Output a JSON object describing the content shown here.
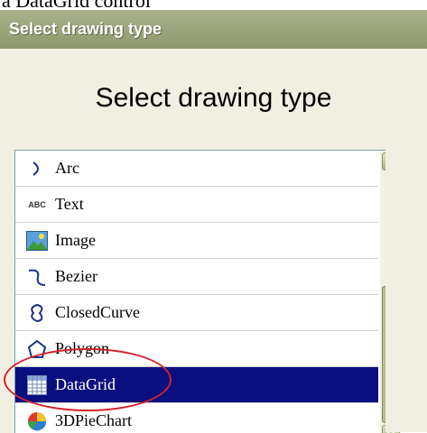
{
  "caption": "a DataGrid control",
  "window": {
    "title": "Select drawing type"
  },
  "heading": "Select drawing type",
  "list": {
    "items": [
      {
        "label": "Arc",
        "icon": "arc-icon"
      },
      {
        "label": "Text",
        "icon": "text-abc-icon"
      },
      {
        "label": "Image",
        "icon": "image-icon"
      },
      {
        "label": "Bezier",
        "icon": "bezier-icon"
      },
      {
        "label": "ClosedCurve",
        "icon": "closed-curve-icon"
      },
      {
        "label": "Polygon",
        "icon": "polygon-icon"
      },
      {
        "label": "DataGrid",
        "icon": "datagrid-icon",
        "selected": true
      },
      {
        "label": "3DPieChart",
        "icon": "pie-chart-icon"
      }
    ]
  },
  "colors": {
    "titlebar": "#9aa37a",
    "selection": "#0a0f7f",
    "annotation": "#d2232a"
  }
}
